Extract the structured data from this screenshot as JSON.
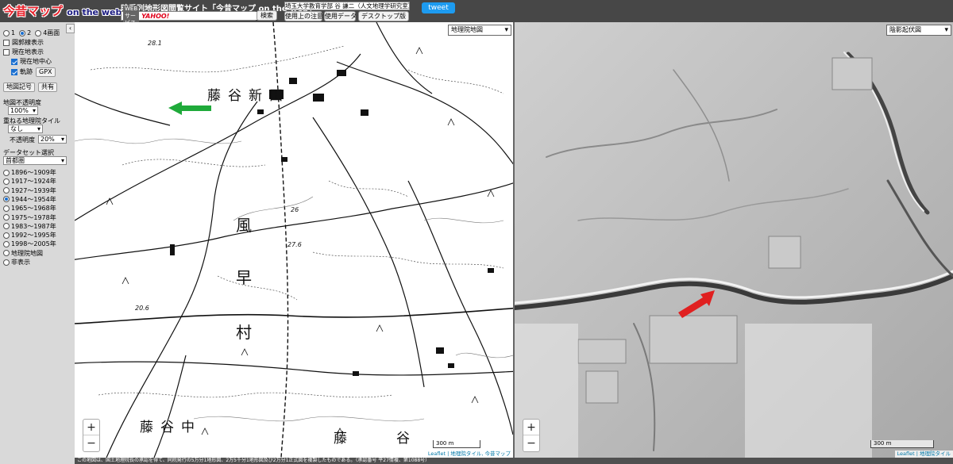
{
  "header": {
    "logo_text": "今昔マップ",
    "logo_suffix": "on the web",
    "site_title": "時系列地形図閲覧サイト「今昔マップ on the web」",
    "websvc_badge": "WEBサービス",
    "yahoo_badge": "YAHOO!",
    "search_placeholder": "",
    "search_label": "検索",
    "affiliation": "埼玉大学教育学部 谷 謙二（人文地理学研究室）",
    "notes_label": "使用上の注意",
    "data_label": "使用データ",
    "desktop_label": "デスクトップ版",
    "tweet_label": "tweet"
  },
  "sidebar": {
    "collapse_label": "‹",
    "screens": [
      "1",
      "2",
      "4画面"
    ],
    "screens_selected": 1,
    "show_map_boundary": "図郭線表示",
    "show_current_location": "現在地表示",
    "center_current": "現在地中心",
    "track": "軌跡",
    "gpx_label": "GPX",
    "map_symbols_label": "地図記号",
    "share_label": "共有",
    "map_opacity_label": "地図不透明度",
    "map_opacity_value": "100%",
    "overlay_tile_label": "重ねる地理院タイル",
    "overlay_tile_value": "なし",
    "overlay_opacity_label": "不透明度",
    "overlay_opacity_value": "20%",
    "dataset_label": "データセット選択",
    "dataset_value": "首都圏",
    "periods": [
      "1896～1909年",
      "1917～1924年",
      "1927～1939年",
      "1944～1954年",
      "1965～1968年",
      "1975～1978年",
      "1983～1987年",
      "1992～1995年",
      "1998～2005年",
      "地理院地図",
      "非表示"
    ],
    "period_selected": 3
  },
  "left_map": {
    "layer_select": "地理院地図",
    "labels": [
      "藤",
      "谷",
      "新",
      "田",
      "風",
      "早",
      "村",
      "藤",
      "谷",
      "中",
      "藤",
      "谷"
    ],
    "numbers": [
      "28.1",
      "26",
      "27.6",
      "20.6"
    ],
    "scale_label": "300 m",
    "attribution": "Leaflet | 地理院タイル, 今昔マップ"
  },
  "right_map": {
    "layer_select": "陰影起伏図",
    "scale_label": "300 m",
    "attribution": "Leaflet | 地理院タイル"
  },
  "zoom": {
    "in": "+",
    "out": "−"
  },
  "footer": "この地図は、国土地理院長の承認を得て、同院発行の5万分1地形図、2万5千分1地形図及び2万分1正式図を複製したものである。（承認番号 平27情複、第1088号）",
  "colors": {
    "green_arrow": "#1faa3a",
    "red_arrow": "#e02020",
    "tweet": "#1d9bf0"
  }
}
